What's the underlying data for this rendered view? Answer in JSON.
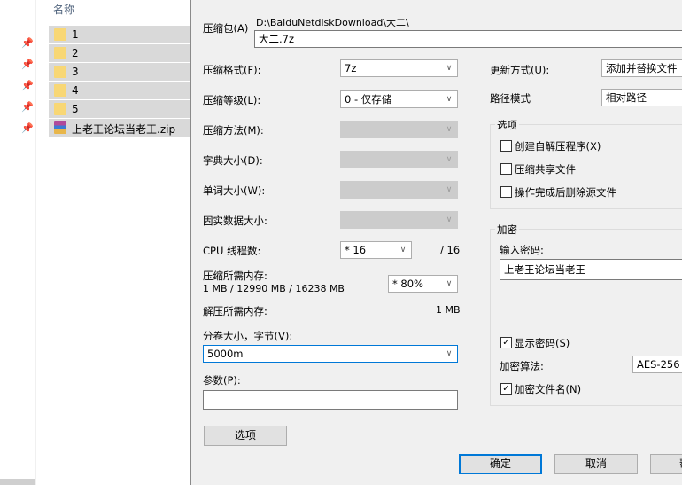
{
  "explorer": {
    "column_name": "名称",
    "rows": [
      {
        "name": "1",
        "type": "folder"
      },
      {
        "name": "2",
        "type": "folder"
      },
      {
        "name": "3",
        "type": "folder"
      },
      {
        "name": "4",
        "type": "folder"
      },
      {
        "name": "5",
        "type": "folder"
      },
      {
        "name": "上老王论坛当老王.zip",
        "type": "zip"
      }
    ]
  },
  "dialog": {
    "archive_label": "压缩包(A)",
    "archive_path": "D:\\BaiduNetdiskDownload\\大二\\",
    "archive_name": "大二.7z",
    "format_label": "压缩格式(F):",
    "format_value": "7z",
    "level_label": "压缩等级(L):",
    "level_value": "0 - 仅存储",
    "method_label": "压缩方法(M):",
    "dict_label": "字典大小(D):",
    "word_label": "单词大小(W):",
    "solid_label": "固实数据大小:",
    "threads_label": "CPU 线程数:",
    "threads_value": "* 16",
    "threads_total": "/ 16",
    "mem_compress_label": "压缩所需内存:",
    "mem_compress_detail": "1 MB / 12990 MB / 16238 MB",
    "mem_percent": "* 80%",
    "mem_decompress_label": "解压所需内存:",
    "mem_decompress_value": "1 MB",
    "volume_label": "分卷大小，字节(V):",
    "volume_value": "5000m",
    "params_label": "参数(P):",
    "params_value": "",
    "options_button": "选项",
    "update_label": "更新方式(U):",
    "update_value": "添加并替换文件",
    "path_mode_label": "路径模式",
    "path_mode_value": "相对路径",
    "options_group": "选项",
    "opt_sfx": "创建自解压程序(X)",
    "opt_shared": "压缩共享文件",
    "opt_delete": "操作完成后删除源文件",
    "encrypt_group": "加密",
    "password_label": "输入密码:",
    "password_value": "上老王论坛当老王",
    "show_password": "显示密码(S)",
    "algo_label": "加密算法:",
    "algo_value": "AES-256",
    "encrypt_names": "加密文件名(N)",
    "ok_button": "确定",
    "cancel_button": "取消",
    "help_button": "帮"
  }
}
